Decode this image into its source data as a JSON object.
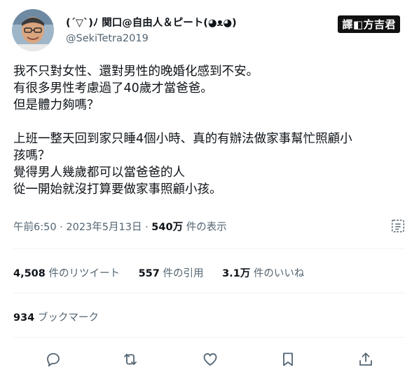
{
  "author": {
    "display_name": "(´▽`)ﾉ 関口@自由人＆ピート(◕ᴥ◕)",
    "handle": "@SekiTetra2019",
    "avatar_icon": "avatar-photo"
  },
  "watermark": "譯◧方吉君",
  "tweet": {
    "lines": [
      "我不只對女性、還對男性的晚婚化感到不安。",
      "有很多男性考慮過了40歲才當爸爸。",
      "但是體力夠嗎？",
      "",
      "上班一整天回到家只睡4個小時、真的有辦法做家事幫忙照顧小",
      "孩嗎？",
      "覺得男人幾歲都可以當爸爸的人",
      "從一開始就沒打算要做家事照顧小孩。"
    ]
  },
  "meta": {
    "time": "午前6:50",
    "date": "2023年5月13日",
    "separator": "·",
    "views_count": "540万",
    "views_label": "件の表示"
  },
  "stats": {
    "retweets_count": "4,508",
    "retweets_label": "件のリツイート",
    "quotes_count": "557",
    "quotes_label": "件の引用",
    "likes_count": "3.1万",
    "likes_label": "件のいいね"
  },
  "bookmarks": {
    "count": "934",
    "label": "ブックマーク"
  },
  "actions": {
    "icons": [
      "reply-icon",
      "retweet-icon",
      "like-icon",
      "bookmark-icon",
      "share-icon"
    ],
    "icon_color": "#536471"
  }
}
